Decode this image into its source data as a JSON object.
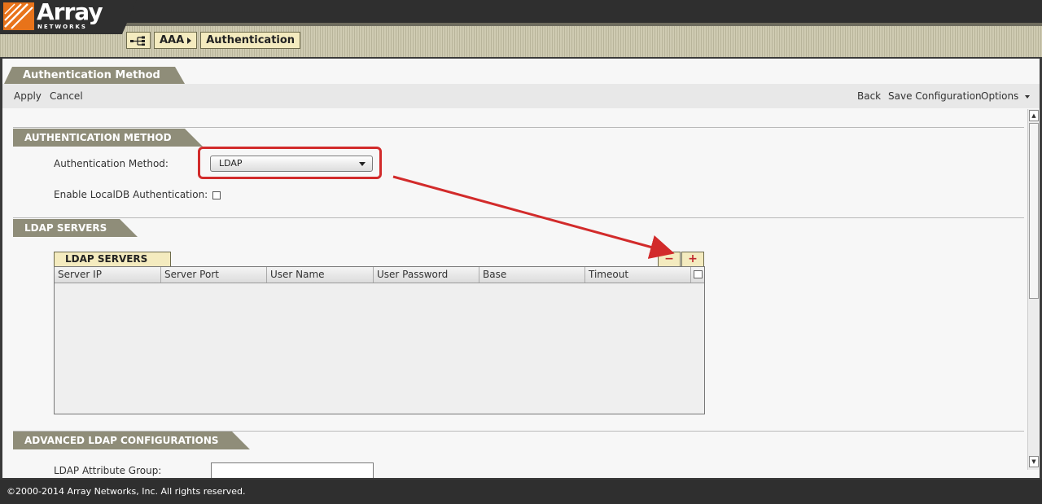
{
  "brand": {
    "name": "Array",
    "sub": "NETWORKS",
    "colors": {
      "orange": "#e8731a",
      "accent": "#8f8d79",
      "highlight": "#d22b2b"
    }
  },
  "breadcrumb": {
    "home_icon": "network-icon",
    "parent": "AAA",
    "current": "Authentication"
  },
  "page": {
    "tab": "Authentication Method"
  },
  "toolbar": {
    "apply": "Apply",
    "cancel": "Cancel",
    "back": "Back",
    "save": "Save Configuration",
    "options": "Options"
  },
  "section_auth": {
    "title": "AUTHENTICATION METHOD",
    "method_label": "Authentication Method:",
    "method_value": "LDAP",
    "localdb_label": "Enable LocalDB Authentication:",
    "localdb_checked": false
  },
  "section_ldap": {
    "title": "LDAP SERVERS",
    "grid_title": "LDAP SERVERS",
    "remove_label": "−",
    "add_label": "+",
    "columns": [
      "Server IP",
      "Server Port",
      "User Name",
      "User Password",
      "Base",
      "Timeout"
    ],
    "rows": []
  },
  "section_advanced": {
    "title": "ADVANCED LDAP CONFIGURATIONS",
    "attr_label": "LDAP Attribute Group:"
  },
  "footer": {
    "copyright": "©2000-2014 Array Networks, Inc. All rights reserved."
  }
}
